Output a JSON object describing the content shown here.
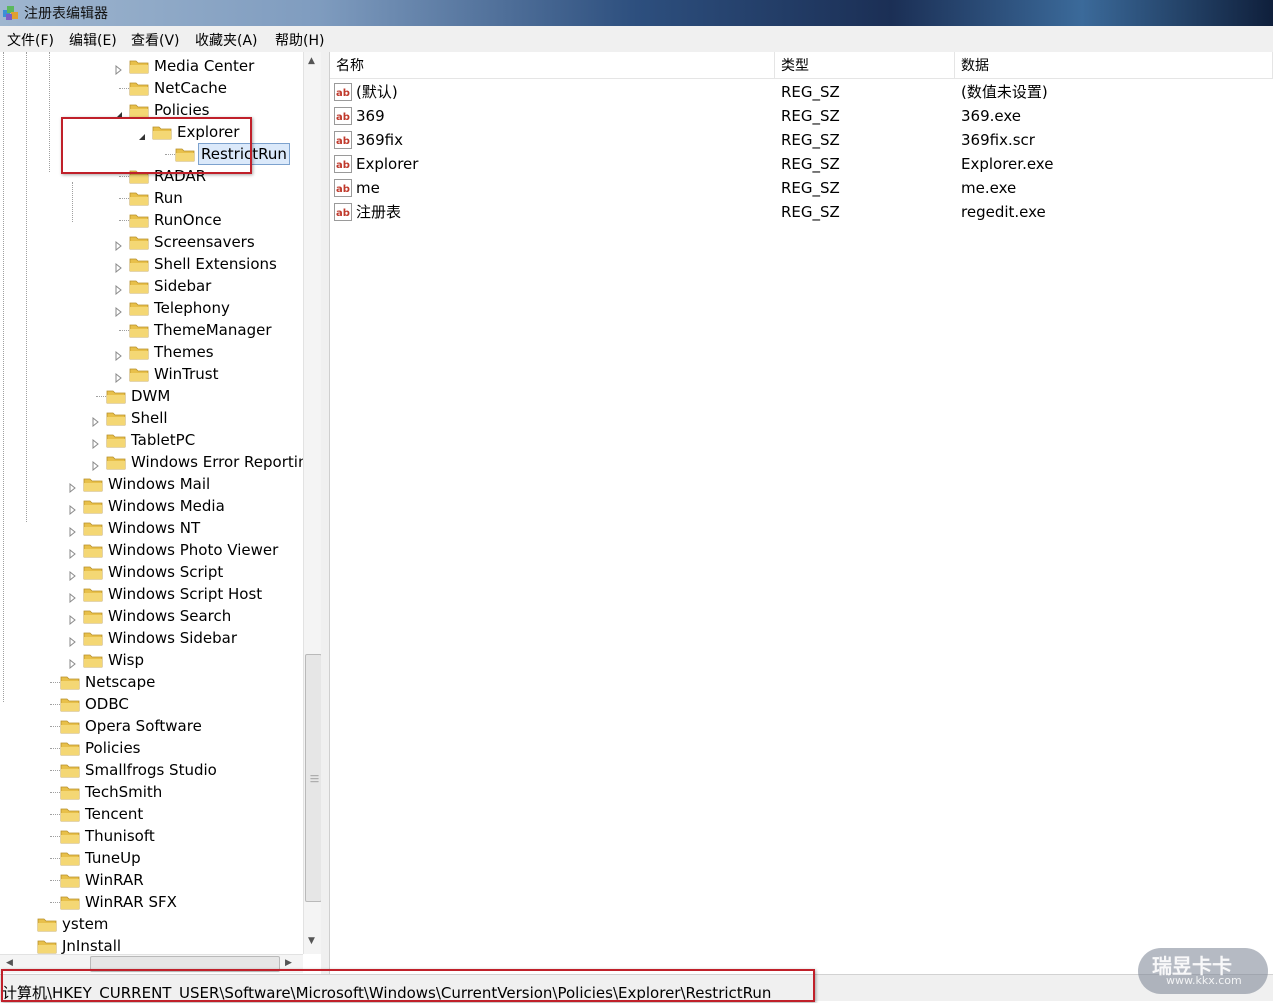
{
  "window": {
    "title": "注册表编辑器"
  },
  "menu": [
    "文件(F)",
    "编辑(E)",
    "查看(V)",
    "收藏夹(A)",
    "帮助(H)"
  ],
  "tree": [
    {
      "label": "Media Center",
      "expander": "collapsed"
    },
    {
      "label": "NetCache",
      "expander": "none"
    },
    {
      "label": "Policies",
      "expander": "expanded"
    },
    {
      "label": "Explorer",
      "expander": "expanded"
    },
    {
      "label": "RestrictRun",
      "expander": "none",
      "selected": true
    },
    {
      "label": "RADAR",
      "expander": "none"
    },
    {
      "label": "Run",
      "expander": "none"
    },
    {
      "label": "RunOnce",
      "expander": "none"
    },
    {
      "label": "Screensavers",
      "expander": "collapsed"
    },
    {
      "label": "Shell Extensions",
      "expander": "collapsed"
    },
    {
      "label": "Sidebar",
      "expander": "collapsed"
    },
    {
      "label": "Telephony",
      "expander": "collapsed"
    },
    {
      "label": "ThemeManager",
      "expander": "none"
    },
    {
      "label": "Themes",
      "expander": "collapsed"
    },
    {
      "label": "WinTrust",
      "expander": "collapsed"
    },
    {
      "label": "DWM",
      "expander": "none"
    },
    {
      "label": "Shell",
      "expander": "collapsed"
    },
    {
      "label": "TabletPC",
      "expander": "collapsed"
    },
    {
      "label": "Windows Error Reporting",
      "expander": "collapsed"
    },
    {
      "label": "Windows Mail",
      "expander": "collapsed"
    },
    {
      "label": "Windows Media",
      "expander": "collapsed"
    },
    {
      "label": "Windows NT",
      "expander": "collapsed"
    },
    {
      "label": "Windows Photo Viewer",
      "expander": "collapsed"
    },
    {
      "label": "Windows Script",
      "expander": "collapsed"
    },
    {
      "label": "Windows Script Host",
      "expander": "collapsed"
    },
    {
      "label": "Windows Search",
      "expander": "collapsed"
    },
    {
      "label": "Windows Sidebar",
      "expander": "collapsed"
    },
    {
      "label": "Wisp",
      "expander": "collapsed"
    },
    {
      "label": "Netscape",
      "expander": "none"
    },
    {
      "label": "ODBC",
      "expander": "none"
    },
    {
      "label": "Opera Software",
      "expander": "none"
    },
    {
      "label": "Policies",
      "expander": "none"
    },
    {
      "label": "Smallfrogs Studio",
      "expander": "none"
    },
    {
      "label": "TechSmith",
      "expander": "none"
    },
    {
      "label": "Tencent",
      "expander": "none"
    },
    {
      "label": "Thunisoft",
      "expander": "none"
    },
    {
      "label": "TuneUp",
      "expander": "none"
    },
    {
      "label": "WinRAR",
      "expander": "none"
    },
    {
      "label": "WinRAR SFX",
      "expander": "none"
    },
    {
      "label": "ystem",
      "expander": "none"
    },
    {
      "label": "JnInstall",
      "expander": "none"
    }
  ],
  "list": {
    "columns": [
      "名称",
      "类型",
      "数据"
    ],
    "rows": [
      {
        "name": "(默认)",
        "type": "REG_SZ",
        "data": "(数值未设置)"
      },
      {
        "name": "369",
        "type": "REG_SZ",
        "data": "369.exe"
      },
      {
        "name": "369fix",
        "type": "REG_SZ",
        "data": "369fix.scr"
      },
      {
        "name": "Explorer",
        "type": "REG_SZ",
        "data": "Explorer.exe"
      },
      {
        "name": "me",
        "type": "REG_SZ",
        "data": "me.exe"
      },
      {
        "name": "注册表",
        "type": "REG_SZ",
        "data": "regedit.exe"
      }
    ]
  },
  "status": {
    "path": "计算机\\HKEY_CURRENT_USER\\Software\\Microsoft\\Windows\\CurrentVersion\\Policies\\Explorer\\RestrictRun"
  },
  "watermark": {
    "line1": "瑞昱卡卡",
    "line2": "www.kkx.com"
  },
  "colors": {
    "highlight": "#c0202a",
    "selection": "#dbe9fa",
    "folder": "#e8c04a"
  }
}
